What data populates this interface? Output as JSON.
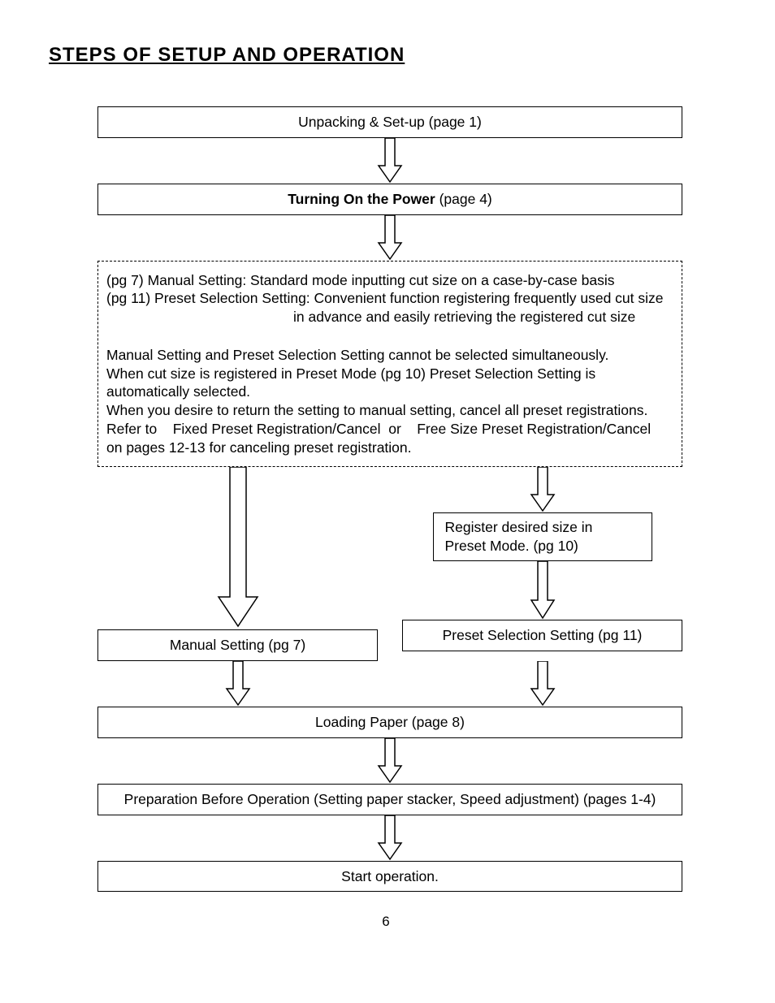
{
  "title": "STEPS OF SETUP AND OPERATION",
  "boxes": {
    "unpack": "Unpacking & Set-up (page 1)",
    "power_bold": "Turning On the Power",
    "power_rest": " (page 4)",
    "manual_setting": "Manual Setting (pg 7)",
    "preset_setting": "Preset Selection Setting (pg 11)",
    "loading_paper": "Loading Paper (page 8)",
    "preparation": "Preparation Before Operation (Setting paper stacker, Speed adjustment) (pages 1-4)",
    "start": "Start operation."
  },
  "register_box": {
    "line1": "Register desired size in",
    "line2": "Preset Mode. (pg 10)"
  },
  "dashed": {
    "l1a": "(pg 7)",
    "l1b": "Manual Setting: Standard mode inputting cut size on a case-by-case basis",
    "l2a": "(pg 11)",
    "l2b": "Preset Selection Setting: Convenient function registering frequently used cut size",
    "l3": "in advance and easily retrieving the registered cut size",
    "p2a": "Manual Setting and Preset Selection Setting cannot be selected simultaneously.",
    "p2b": "When cut size is registered in Preset Mode (pg 10) Preset Selection Setting is automatically selected.",
    "p2c": "When you desire to return the setting to manual setting, cancel all preset registrations.",
    "p2d": "Refer to    Fixed Preset Registration/Cancel  or    Free Size Preset Registration/Cancel",
    "p2e": "on pages 12-13 for canceling preset registration."
  },
  "page_number": "6"
}
